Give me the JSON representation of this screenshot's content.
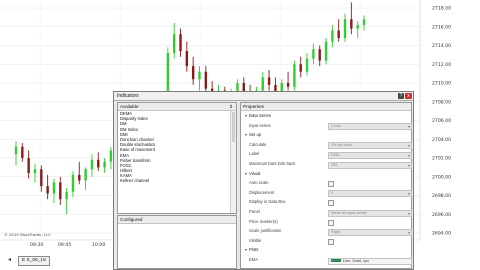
{
  "chart_data": {
    "type": "candlestick",
    "y_ticks": [
      "2718.00",
      "2716.00",
      "2714.00",
      "2712.00",
      "2710.00",
      "2708.00",
      "2706.00",
      "2704.00",
      "2702.00",
      "2700.00",
      "2698.00",
      "2696.00",
      "2694.00"
    ],
    "x_ticks": [
      "09:30",
      "09:45",
      "10:00"
    ],
    "up_color": "#33cc33",
    "down_color": "#8b1a1a",
    "candles": [
      {
        "o": 2702.4,
        "h": 2703.8,
        "l": 2701.2,
        "c": 2703.2
      },
      {
        "o": 2703.2,
        "h": 2703.6,
        "l": 2701.6,
        "c": 2702.0
      },
      {
        "o": 2702.0,
        "h": 2702.8,
        "l": 2699.8,
        "c": 2700.4
      },
      {
        "o": 2700.4,
        "h": 2701.4,
        "l": 2699.4,
        "c": 2700.8
      },
      {
        "o": 2700.8,
        "h": 2701.2,
        "l": 2698.4,
        "c": 2699.0
      },
      {
        "o": 2699.0,
        "h": 2700.2,
        "l": 2697.6,
        "c": 2698.2
      },
      {
        "o": 2698.2,
        "h": 2699.8,
        "l": 2697.2,
        "c": 2699.4
      },
      {
        "o": 2699.4,
        "h": 2700.0,
        "l": 2697.0,
        "c": 2697.6
      },
      {
        "o": 2697.6,
        "h": 2698.8,
        "l": 2696.0,
        "c": 2698.4
      },
      {
        "o": 2698.4,
        "h": 2700.6,
        "l": 2697.8,
        "c": 2700.2
      },
      {
        "o": 2700.2,
        "h": 2701.6,
        "l": 2699.2,
        "c": 2699.6
      },
      {
        "o": 2699.6,
        "h": 2701.0,
        "l": 2698.6,
        "c": 2700.8
      },
      {
        "o": 2700.8,
        "h": 2702.4,
        "l": 2700.0,
        "c": 2701.8
      },
      {
        "o": 2701.8,
        "h": 2702.6,
        "l": 2700.6,
        "c": 2701.0
      },
      {
        "o": 2701.0,
        "h": 2702.0,
        "l": 2700.4,
        "c": 2701.6
      },
      {
        "o": 2701.6,
        "h": 2703.2,
        "l": 2700.8,
        "c": 2702.8
      },
      {
        "o": 2702.8,
        "h": 2703.6,
        "l": 2701.6,
        "c": 2702.2
      },
      {
        "o": 2702.2,
        "h": 2704.8,
        "l": 2701.8,
        "c": 2704.4
      },
      {
        "o": 2704.4,
        "h": 2705.2,
        "l": 2703.2,
        "c": 2703.8
      },
      {
        "o": 2703.8,
        "h": 2706.8,
        "l": 2703.4,
        "c": 2706.2
      },
      {
        "o": 2706.2,
        "h": 2707.4,
        "l": 2705.0,
        "c": 2705.6
      },
      {
        "o": 2705.6,
        "h": 2708.6,
        "l": 2705.2,
        "c": 2708.0
      },
      {
        "o": 2708.0,
        "h": 2709.0,
        "l": 2707.0,
        "c": 2707.4
      },
      {
        "o": 2707.4,
        "h": 2708.0,
        "l": 2706.2,
        "c": 2706.8
      },
      {
        "o": 2706.8,
        "h": 2713.8,
        "l": 2706.4,
        "c": 2713.2
      },
      {
        "o": 2713.2,
        "h": 2716.4,
        "l": 2712.6,
        "c": 2715.2
      },
      {
        "o": 2715.2,
        "h": 2715.8,
        "l": 2712.8,
        "c": 2713.4
      },
      {
        "o": 2713.4,
        "h": 2714.4,
        "l": 2711.2,
        "c": 2711.8
      },
      {
        "o": 2711.8,
        "h": 2712.8,
        "l": 2709.8,
        "c": 2710.4
      },
      {
        "o": 2710.4,
        "h": 2711.8,
        "l": 2709.2,
        "c": 2711.2
      },
      {
        "o": 2711.2,
        "h": 2711.8,
        "l": 2708.6,
        "c": 2709.4
      },
      {
        "o": 2709.4,
        "h": 2710.2,
        "l": 2708.0,
        "c": 2708.6
      },
      {
        "o": 2708.6,
        "h": 2709.8,
        "l": 2707.8,
        "c": 2709.2
      },
      {
        "o": 2709.2,
        "h": 2709.6,
        "l": 2707.4,
        "c": 2708.0
      },
      {
        "o": 2708.0,
        "h": 2709.4,
        "l": 2707.6,
        "c": 2708.8
      },
      {
        "o": 2708.8,
        "h": 2710.4,
        "l": 2708.4,
        "c": 2710.0
      },
      {
        "o": 2710.0,
        "h": 2710.6,
        "l": 2708.6,
        "c": 2709.0
      },
      {
        "o": 2709.0,
        "h": 2709.8,
        "l": 2707.8,
        "c": 2708.4
      },
      {
        "o": 2708.4,
        "h": 2709.6,
        "l": 2707.6,
        "c": 2709.2
      },
      {
        "o": 2709.2,
        "h": 2711.2,
        "l": 2708.8,
        "c": 2710.6
      },
      {
        "o": 2710.6,
        "h": 2711.4,
        "l": 2709.2,
        "c": 2709.8
      },
      {
        "o": 2709.8,
        "h": 2710.6,
        "l": 2708.6,
        "c": 2709.0
      },
      {
        "o": 2709.0,
        "h": 2710.4,
        "l": 2708.6,
        "c": 2710.0
      },
      {
        "o": 2710.0,
        "h": 2711.2,
        "l": 2709.2,
        "c": 2709.6
      },
      {
        "o": 2709.6,
        "h": 2712.4,
        "l": 2709.2,
        "c": 2712.0
      },
      {
        "o": 2712.0,
        "h": 2712.8,
        "l": 2710.6,
        "c": 2711.2
      },
      {
        "o": 2711.2,
        "h": 2713.2,
        "l": 2710.8,
        "c": 2712.6
      },
      {
        "o": 2712.6,
        "h": 2714.2,
        "l": 2712.0,
        "c": 2713.6
      },
      {
        "o": 2713.6,
        "h": 2714.0,
        "l": 2711.8,
        "c": 2712.4
      },
      {
        "o": 2712.4,
        "h": 2714.8,
        "l": 2712.0,
        "c": 2714.4
      },
      {
        "o": 2714.4,
        "h": 2716.2,
        "l": 2713.8,
        "c": 2715.6
      },
      {
        "o": 2715.6,
        "h": 2716.8,
        "l": 2714.4,
        "c": 2714.8
      },
      {
        "o": 2714.8,
        "h": 2717.4,
        "l": 2714.4,
        "c": 2716.8
      },
      {
        "o": 2716.8,
        "h": 2718.6,
        "l": 2715.2,
        "c": 2715.8
      },
      {
        "o": 2715.8,
        "h": 2716.6,
        "l": 2714.8,
        "c": 2716.2
      },
      {
        "o": 2716.2,
        "h": 2717.2,
        "l": 2715.6,
        "c": 2716.8
      }
    ]
  },
  "chart_copyright": "© 2019 NinjaTrader, LLC",
  "bottom_tab": "E S_06_18",
  "dialog": {
    "title": "Indicators",
    "help_label": "?",
    "close_label": "x",
    "available_header": "Available",
    "configured_header": "Configured",
    "properties_header": "Properties",
    "indicators": [
      "DEMA",
      "Disparity Index",
      "DM",
      "DM Index",
      "DMI",
      "Donchian channel",
      "Double stochastics",
      "Ease of movement",
      "EMA",
      "Fisher transform",
      "FOSC",
      "Hilbert",
      "KAMA",
      "Keltner channel"
    ],
    "properties": [
      {
        "kind": "section",
        "label": "Data Series"
      },
      {
        "kind": "field",
        "label": "Input series",
        "value": "Close"
      },
      {
        "kind": "section",
        "label": "Set up"
      },
      {
        "kind": "field",
        "label": "Calculate",
        "value": "On bar close"
      },
      {
        "kind": "field",
        "label": "Label",
        "value": "EMA"
      },
      {
        "kind": "field",
        "label": "Maximum bars look back",
        "value": "256"
      },
      {
        "kind": "section",
        "label": "Visual"
      },
      {
        "kind": "check",
        "label": "Auto scale"
      },
      {
        "kind": "field",
        "label": "Displacement",
        "value": "0"
      },
      {
        "kind": "check",
        "label": "Display in Data Box"
      },
      {
        "kind": "field",
        "label": "Panel",
        "value": "Same as input series"
      },
      {
        "kind": "check",
        "label": "Price marker(s)"
      },
      {
        "kind": "field",
        "label": "Scale justification",
        "value": "Right"
      },
      {
        "kind": "check",
        "label": "Visible"
      },
      {
        "kind": "section",
        "label": "Plots"
      },
      {
        "kind": "plot",
        "label": "EMA",
        "value": "Line, Solid, 1px"
      }
    ]
  }
}
